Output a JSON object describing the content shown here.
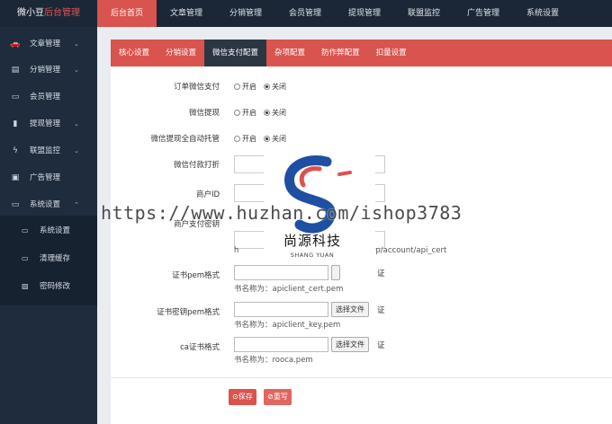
{
  "brand": {
    "part1": "微小豆",
    "part2": "后台管理"
  },
  "topnav": [
    "后台首页",
    "文章管理",
    "分销管理",
    "会员管理",
    "提现管理",
    "联盟监控",
    "广告管理",
    "系统设置"
  ],
  "sidebar": {
    "items": [
      {
        "label": "文章管理",
        "icon": "car-icon",
        "glyph": "🚗"
      },
      {
        "label": "分销管理",
        "icon": "file-icon",
        "glyph": "▤"
      },
      {
        "label": "会员管理",
        "icon": "card-icon",
        "glyph": "▭"
      },
      {
        "label": "提现管理",
        "icon": "bar-chart-icon",
        "glyph": "▮"
      },
      {
        "label": "联盟监控",
        "icon": "bolt-icon",
        "glyph": "ϟ"
      },
      {
        "label": "广告管理",
        "icon": "briefcase-icon",
        "glyph": "▣"
      },
      {
        "label": "系统设置",
        "icon": "laptop-icon",
        "glyph": "▭"
      }
    ],
    "subitems": [
      {
        "label": "系统设置",
        "icon": "laptop-icon",
        "glyph": "▭"
      },
      {
        "label": "清理缓存",
        "icon": "laptop-icon",
        "glyph": "▭"
      },
      {
        "label": "密码修改",
        "icon": "image-icon",
        "glyph": "▨"
      }
    ]
  },
  "tabs": [
    "核心设置",
    "分销设置",
    "微信支付配置",
    "杂项配置",
    "防作弊配置",
    "扣量设置"
  ],
  "form": {
    "order_pay_label": "订单微信支付",
    "withdraw_label": "微信提现",
    "auto_label": "微信提现全自动托管",
    "opt_on": "开启",
    "opt_off": "关闭",
    "discount_label": "微信付款打折",
    "merchant_label": "商户ID",
    "key_label": "商户支付密钥",
    "url_fragment_left": "h",
    "url_fragment_right": "hp/account/api_cert",
    "cert_pem_label": "证书pem格式",
    "cert_key_label": "证书密钥pem格式",
    "ca_label": "ca证书格式",
    "choose_file": "选择文件",
    "trail": "证",
    "hint_cert": "书名称为：apiclient_cert.pem",
    "hint_key": "书名称为：apiclient_key.pem",
    "hint_ca": "书名称为：rooca.pem"
  },
  "buttons": {
    "save": "⊙保存",
    "reset": "⊘重写"
  },
  "watermark": {
    "url": "https://www.huzhan.com/ishop3783",
    "brand": "尚源科技",
    "sub": "SHANG YUAN"
  },
  "colors": {
    "accent": "#d9534f",
    "topbar": "#1b2737",
    "sidebar": "#1f2c3d",
    "active_tab": "#2b3643"
  }
}
